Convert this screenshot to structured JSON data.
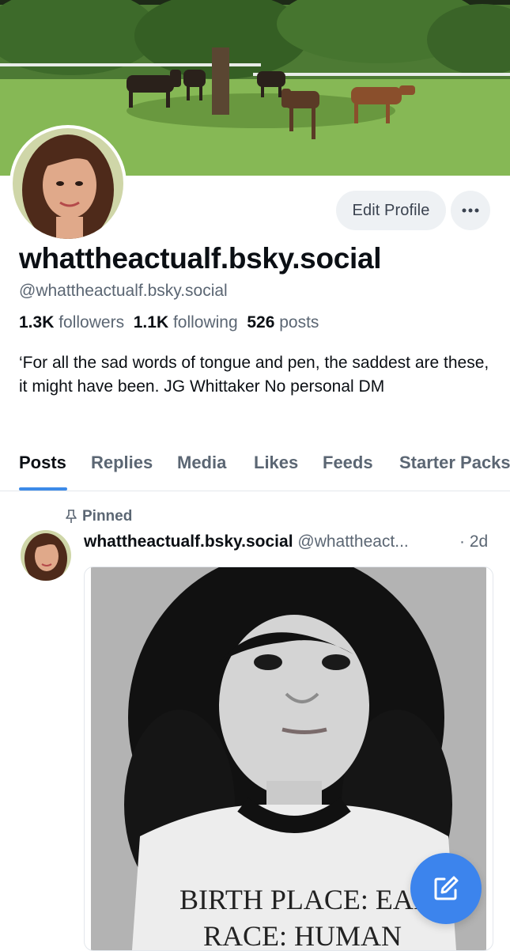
{
  "profile": {
    "display_name": "whattheactualf.bsky.social",
    "handle": "@whattheactualf.bsky.social",
    "followers_count": "1.3K",
    "followers_label": "followers",
    "following_count": "1.1K",
    "following_label": "following",
    "posts_count": "526",
    "posts_label": "posts",
    "bio": "‘For all the sad words of tongue and pen, the saddest are these, it might have been. JG Whittaker No personal DM"
  },
  "actions": {
    "edit_profile_label": "Edit Profile",
    "more_icon": "ellipsis-icon"
  },
  "tabs": [
    {
      "label": "Posts",
      "active": true
    },
    {
      "label": "Replies",
      "active": false
    },
    {
      "label": "Media",
      "active": false
    },
    {
      "label": "Likes",
      "active": false
    },
    {
      "label": "Feeds",
      "active": false
    },
    {
      "label": "Starter Packs",
      "active": false
    }
  ],
  "pinned_post": {
    "pinned_label": "Pinned",
    "pin_icon": "pin-icon",
    "author_name": "whattheactualf.bsky.social",
    "author_handle": "@whattheact...",
    "time": "· 2d",
    "image_text_line1": "BIRTH PLACE: EARTH",
    "image_text_line2": "RACE: HUMAN"
  },
  "compose": {
    "icon": "compose-icon"
  },
  "colors": {
    "accent": "#3c8ae8",
    "fab": "#3c84ed",
    "muted_text": "#5b6673",
    "button_bg": "#eef1f4"
  }
}
